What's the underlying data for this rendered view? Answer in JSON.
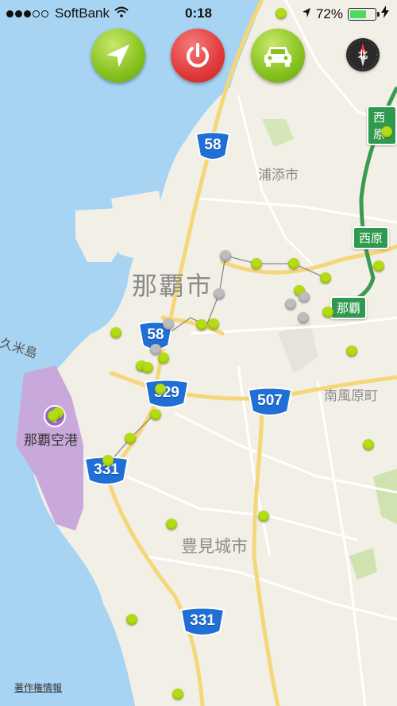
{
  "status_bar": {
    "carrier": "SoftBank",
    "time": "0:18",
    "battery": "72%",
    "battery_level": 0.72
  },
  "buttons": {
    "locate": "location-arrow-icon",
    "power": "power-icon",
    "vehicle": "car-icon"
  },
  "compass_label": "北",
  "place_labels": {
    "urasoe": "浦添市",
    "naha_city": "那覇市",
    "kumejima": "久米島",
    "naha_airport": "那覇空港",
    "minami_kazehara": "南風原町",
    "tomigusuku": "豊見城市"
  },
  "route_shields": {
    "r58_north": "58",
    "r58_south": "58",
    "r329": "329",
    "r507": "507",
    "r331_west": "331",
    "r331_south": "331"
  },
  "expressway_signs": {
    "nishihara_top": "西原",
    "nishihara": "西原",
    "naha": "那覇"
  },
  "copyright": "著作権情報",
  "colors": {
    "water": "#a6d4f2",
    "land": "#f2efe6",
    "road": "#f5d77a",
    "poi_green": "#b4dc14",
    "poi_gray": "#bdbdbd",
    "shield_blue": "#1f6fd6",
    "expressway": "#3a9b4f",
    "airport": "#c9a9dc"
  }
}
